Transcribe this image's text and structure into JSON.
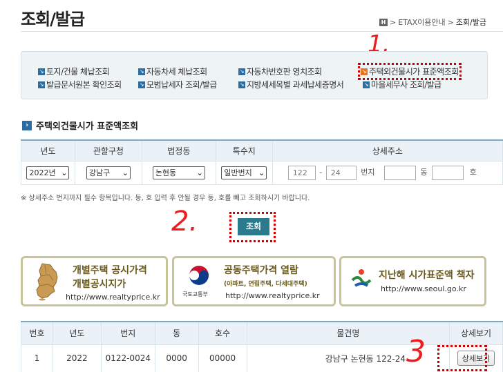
{
  "header": {
    "title": "조회/발급",
    "breadcrumb": {
      "home": "H",
      "items": [
        "ETAX이용안내",
        "조회/발급"
      ]
    }
  },
  "quick_links": [
    {
      "label": "토지/건물 체납조회"
    },
    {
      "label": "자동차세 체납조회"
    },
    {
      "label": "자동차번호판 영치조회"
    },
    {
      "label": "주택외건물시가 표준액조회",
      "active": true
    },
    {
      "label": "발급문서원본 확인조회"
    },
    {
      "label": "모범납세자 조회/발급"
    },
    {
      "label": "지방세세목별 과세납세증명서"
    },
    {
      "label": "마을세무사 조회/발급"
    }
  ],
  "section": {
    "title": "주택외건물시가 표준액조회"
  },
  "search_form": {
    "headers": [
      "년도",
      "관할구청",
      "법정동",
      "특수지",
      "상세주소"
    ],
    "year": "2022년",
    "district": "강남구",
    "dong": "논현동",
    "special": "일반번지",
    "bunji_main": "122",
    "bunji_dash": "-",
    "bunji_sub": "24",
    "bunji_label": "번지",
    "dong_label": "동",
    "ho_label": "호",
    "notice": "※ 상세주소 번지까지 필수 항목입니다. 동, 호 입력 후 안될 경우 동, 호를 빼고 조회하시기 바랍니다.",
    "search_button": "조회"
  },
  "banners": [
    {
      "title_1": "개별주택 공시가격",
      "title_2": "개별공시지가",
      "url": "http://www.realtyprice.kr"
    },
    {
      "title_1": "공동주택가격 열람",
      "title_2": "(아파트, 연립주택, 다세대주택)",
      "org": "국토교통부",
      "url": "http://www.realtyprice.kr"
    },
    {
      "title_1": "지난해 시가표준액 책자",
      "url": "http://www.seoul.go.kr"
    }
  ],
  "results": {
    "headers": [
      "번호",
      "년도",
      "번지",
      "동",
      "호수",
      "물건명",
      "상세보기"
    ],
    "rows": [
      {
        "no": "1",
        "year": "2022",
        "bunji": "0122-0024",
        "dong": "0000",
        "ho": "00000",
        "name": "강남구 논현동 122-24",
        "button": "상세보기"
      }
    ]
  },
  "annotations": {
    "step1": "1.",
    "step2": "2.",
    "step3": "3"
  },
  "colors": {
    "accent": "#2b7a8e",
    "link_icon": "#2c6ea3",
    "active_icon": "#e87722",
    "annotation": "#ee1c1c",
    "header_bg": "#eaf2f8"
  }
}
